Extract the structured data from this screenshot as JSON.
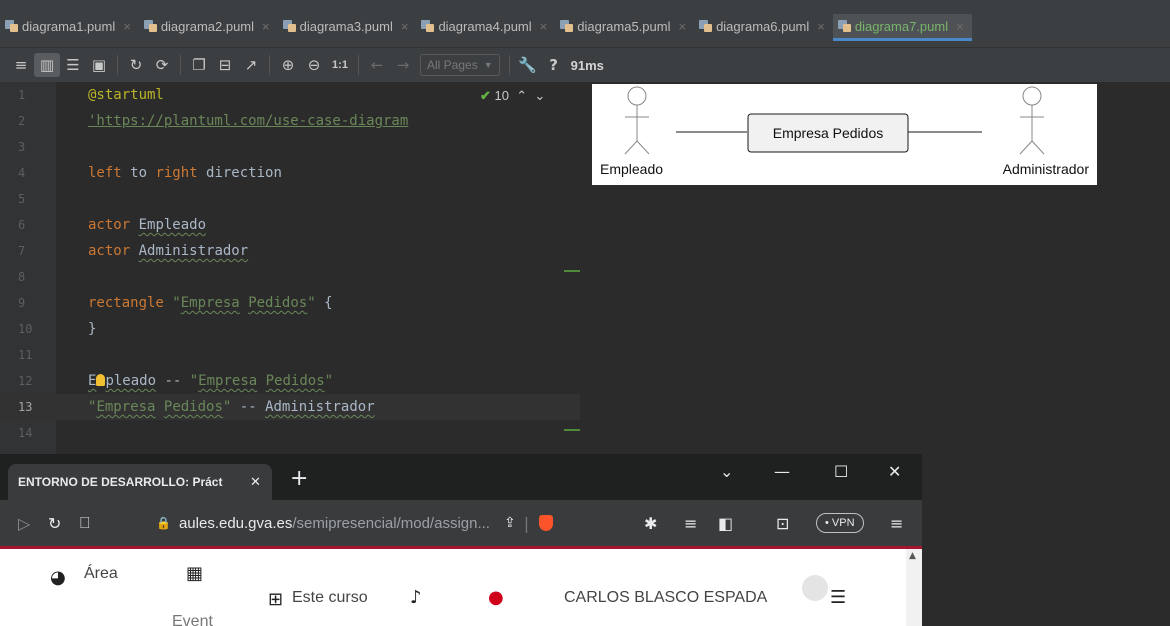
{
  "ide": {
    "tabs": [
      {
        "label": "diagrama1.puml",
        "active": false
      },
      {
        "label": "diagrama2.puml",
        "active": false
      },
      {
        "label": "diagrama3.puml",
        "active": false
      },
      {
        "label": "diagrama4.puml",
        "active": false
      },
      {
        "label": "diagrama5.puml",
        "active": false
      },
      {
        "label": "diagrama6.puml",
        "active": false
      },
      {
        "label": "diagrama7.puml",
        "active": true
      }
    ],
    "toolbar": {
      "pages_select": "All Pages",
      "zoom_actual": "1:1",
      "help": "?",
      "timing": "91ms"
    },
    "editor": {
      "inspection_count": "10",
      "current_line": 13,
      "line_numbers": [
        "1",
        "2",
        "3",
        "4",
        "5",
        "6",
        "7",
        "8",
        "9",
        "10",
        "11",
        "12",
        "13",
        "14"
      ],
      "lines": [
        "@startuml",
        "'https://plantuml.com/use-case-diagram",
        "",
        "left to right direction",
        "",
        "actor Empleado",
        "actor Administrador",
        "",
        "rectangle \"Empresa Pedidos\" {",
        "}",
        "",
        "Empleado -- \"Empresa Pedidos\"",
        "\"Empresa Pedidos\" -- Administrador",
        ""
      ]
    },
    "diagram": {
      "actors": [
        "Empleado",
        "Administrador"
      ],
      "rectangle": "Empresa Pedidos"
    }
  },
  "browser": {
    "tab_title": "ENTORNO DE DESARROLLO: Práct",
    "url_domain": "aules.edu.gva.es",
    "url_path": "/semipresencial/mod/assign...",
    "vpn_label": "• VPN",
    "page": {
      "area_label": "Área",
      "course_label": "Este curso",
      "user_name": "CARLOS BLASCO ESPADA",
      "partial_text": "Event"
    }
  }
}
